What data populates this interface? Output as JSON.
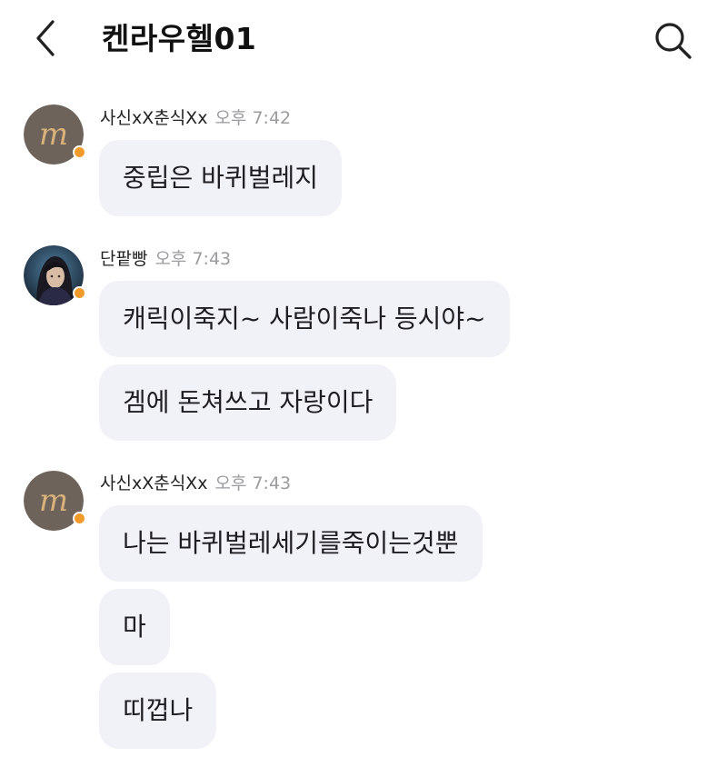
{
  "header": {
    "title": "켄라우헬01",
    "back_icon": "chevron-left-icon",
    "search_icon": "search-icon"
  },
  "colors": {
    "bubble_bg": "#f1f1f8",
    "online_dot": "#f39a2b",
    "time_text": "#9b9ba0"
  },
  "messages": [
    {
      "sender": "사신xX춘식Xx",
      "time": "오후 7:42",
      "avatar": "m-logo-avatar",
      "bubbles": [
        "중립은 바퀴벌레지"
      ]
    },
    {
      "sender": "단팥빵",
      "time": "오후 7:43",
      "avatar": "character-portrait-avatar",
      "bubbles": [
        "캐릭이죽지~ 사람이죽나 등시야~",
        "겜에 돈쳐쓰고 자랑이다"
      ]
    },
    {
      "sender": "사신xX춘식Xx",
      "time": "오후 7:43",
      "avatar": "m-logo-avatar",
      "bubbles": [
        "나는 바퀴벌레세기를죽이는것뿐",
        "마",
        "띠껍나"
      ]
    }
  ]
}
